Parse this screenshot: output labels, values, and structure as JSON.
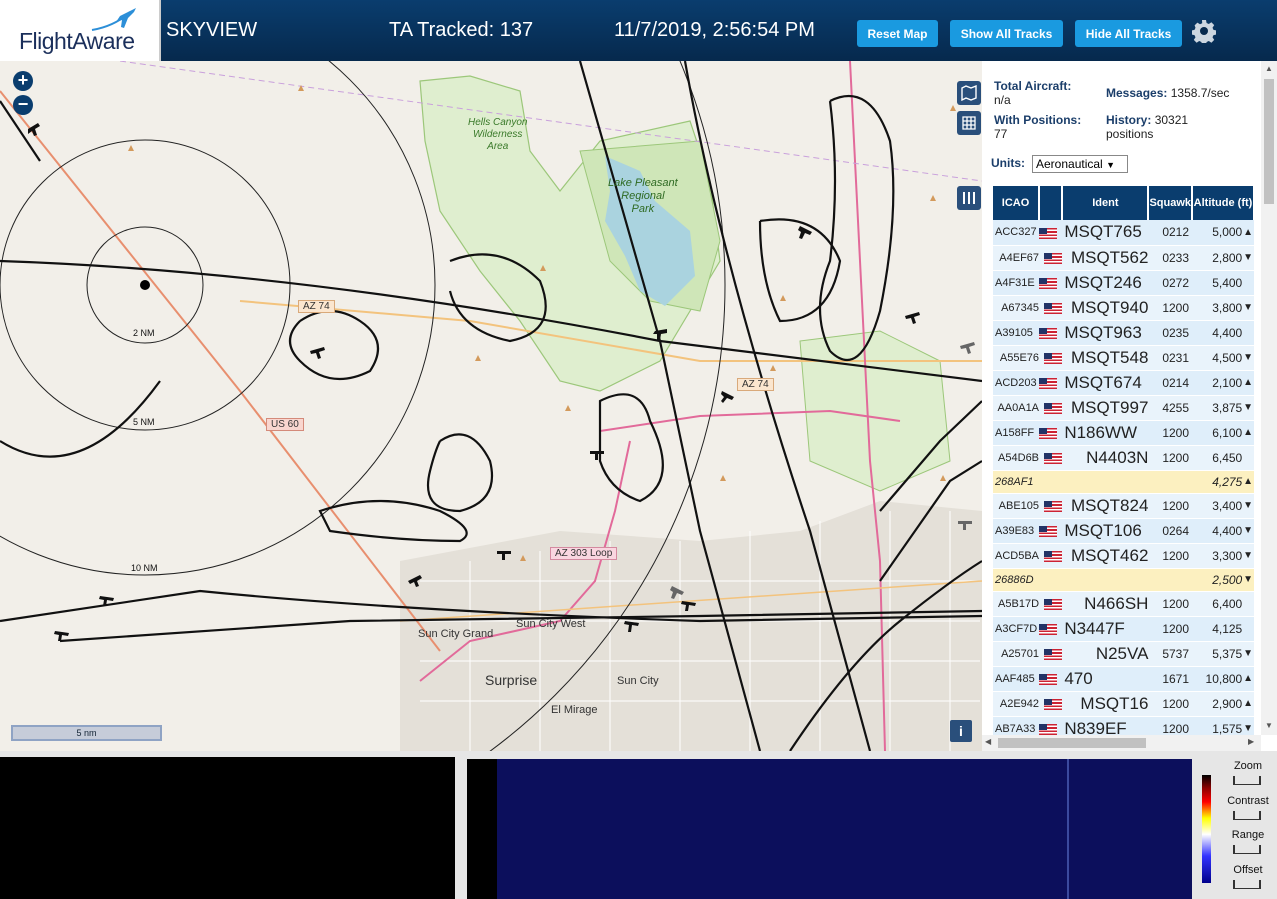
{
  "header": {
    "logo_text": "FlightAware",
    "app_title": "SKYVIEW",
    "tracked": "TA Tracked: 137",
    "datetime": "11/7/2019, 2:56:54 PM",
    "reset_map": "Reset Map",
    "show_tracks": "Show All Tracks",
    "hide_tracks": "Hide All Tracks",
    "settings_icon": "gear-icon",
    "bg_color": "#0a3d6e",
    "button_color": "#1a9ae0"
  },
  "map": {
    "zoom_in": "+",
    "zoom_out": "−",
    "range_2nm": "2 NM",
    "range_5nm": "5 NM",
    "range_10nm": "10 NM",
    "scale": "5 nm",
    "info": "i",
    "place_labels": {
      "hells_canyon": "Hells Canyon",
      "wilderness": "Wilderness",
      "area": "Area",
      "lake_pleasant": "Lake Pleasant",
      "regional": "Regional",
      "park": "Park",
      "surprise": "Surprise",
      "sun_city": "Sun City",
      "sun_city_grand": "Sun City Grand",
      "sun_city_west": "Sun City West",
      "el_mirage": "El Mirage"
    },
    "road_shields": {
      "az74_a": "AZ 74",
      "az74_b": "AZ 74",
      "us60": "US 60",
      "az303": "AZ 303 Loop"
    }
  },
  "panel": {
    "total_aircraft_label": "Total Aircraft:",
    "total_aircraft_value": "n/a",
    "messages_label": "Messages:",
    "messages_value": "1358.7/sec",
    "with_positions_label": "With Positions:",
    "with_positions_value": "77",
    "history_label": "History:",
    "history_value": "30321",
    "history_unit": "positions",
    "units_label": "Units:",
    "units_value": "Aeronautical",
    "columns": [
      "ICAO",
      "Ident",
      "Squawk",
      "Altitude (ft)"
    ],
    "rows": [
      {
        "icao": "ACC327",
        "flag": true,
        "ident": "MSQT765",
        "squawk": "0212",
        "alt": "5,000",
        "trend": "▲"
      },
      {
        "icao": "A4EF67",
        "flag": true,
        "ident": "MSQT562",
        "squawk": "0233",
        "alt": "2,800",
        "trend": "▼"
      },
      {
        "icao": "A4F31E",
        "flag": true,
        "ident": "MSQT246",
        "squawk": "0272",
        "alt": "5,400",
        "trend": ""
      },
      {
        "icao": "A67345",
        "flag": true,
        "ident": "MSQT940",
        "squawk": "1200",
        "alt": "3,800",
        "trend": "▼"
      },
      {
        "icao": "A39105",
        "flag": true,
        "ident": "MSQT963",
        "squawk": "0235",
        "alt": "4,400",
        "trend": ""
      },
      {
        "icao": "A55E76",
        "flag": true,
        "ident": "MSQT548",
        "squawk": "0231",
        "alt": "4,500",
        "trend": "▼"
      },
      {
        "icao": "ACD203",
        "flag": true,
        "ident": "MSQT674",
        "squawk": "0214",
        "alt": "2,100",
        "trend": "▲"
      },
      {
        "icao": "AA0A1A",
        "flag": true,
        "ident": "MSQT997",
        "squawk": "4255",
        "alt": "3,875",
        "trend": "▼"
      },
      {
        "icao": "A158FF",
        "flag": true,
        "ident": "N186WW",
        "squawk": "1200",
        "alt": "6,100",
        "trend": "▲"
      },
      {
        "icao": "A54D6B",
        "flag": true,
        "ident": "N4403N",
        "squawk": "1200",
        "alt": "6,450",
        "trend": ""
      },
      {
        "icao": "268AF1",
        "flag": false,
        "ident": "",
        "squawk": "",
        "alt": "4,275",
        "trend": "▲",
        "highlight": true
      },
      {
        "icao": "ABE105",
        "flag": true,
        "ident": "MSQT824",
        "squawk": "1200",
        "alt": "3,400",
        "trend": "▼"
      },
      {
        "icao": "A39E83",
        "flag": true,
        "ident": "MSQT106",
        "squawk": "0264",
        "alt": "4,400",
        "trend": "▼"
      },
      {
        "icao": "ACD5BA",
        "flag": true,
        "ident": "MSQT462",
        "squawk": "1200",
        "alt": "3,300",
        "trend": "▼"
      },
      {
        "icao": "26886D",
        "flag": false,
        "ident": "",
        "squawk": "",
        "alt": "2,500",
        "trend": "▼",
        "highlight": true
      },
      {
        "icao": "A5B17D",
        "flag": true,
        "ident": "N466SH",
        "squawk": "1200",
        "alt": "6,400",
        "trend": ""
      },
      {
        "icao": "A3CF7D",
        "flag": true,
        "ident": "N3447F",
        "squawk": "1200",
        "alt": "4,125",
        "trend": ""
      },
      {
        "icao": "A25701",
        "flag": true,
        "ident": "N25VA",
        "squawk": "5737",
        "alt": "5,375",
        "trend": "▼"
      },
      {
        "icao": "AAF485",
        "flag": true,
        "ident": "470",
        "squawk": "1671",
        "alt": "10,800",
        "trend": "▲"
      },
      {
        "icao": "A2E942",
        "flag": true,
        "ident": "MSQT16",
        "squawk": "1200",
        "alt": "2,900",
        "trend": "▲"
      },
      {
        "icao": "AB7A33",
        "flag": true,
        "ident": "N839EF",
        "squawk": "1200",
        "alt": "1,575",
        "trend": "▼"
      }
    ]
  },
  "spectrum": {
    "zoom": "Zoom",
    "contrast": "Contrast",
    "range": "Range",
    "offset": "Offset"
  }
}
